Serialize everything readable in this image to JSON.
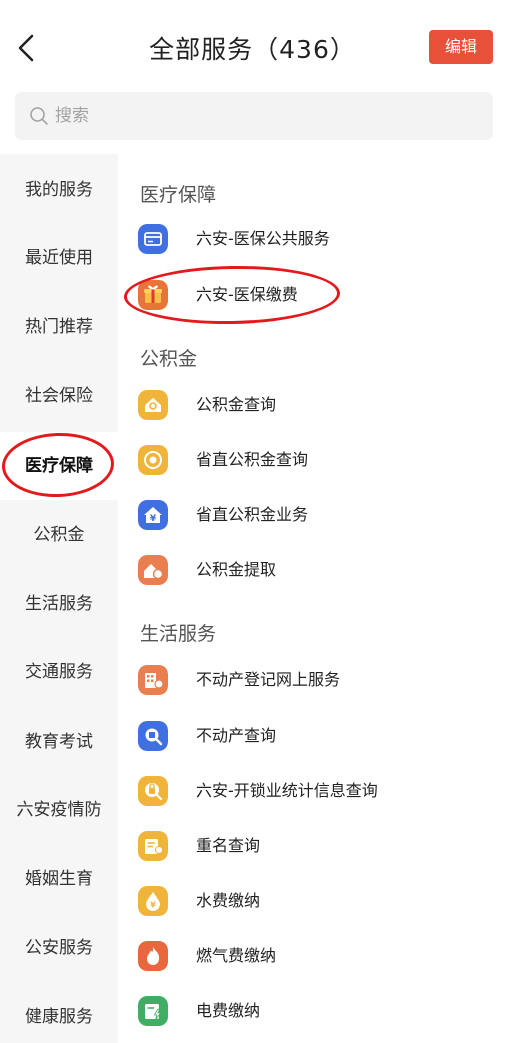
{
  "header": {
    "title": "全部服务（436）",
    "edit_label": "编辑"
  },
  "search": {
    "placeholder": "搜索"
  },
  "sidebar": {
    "items": [
      {
        "label": "我的服务"
      },
      {
        "label": "最近使用"
      },
      {
        "label": "热门推荐"
      },
      {
        "label": "社会保险"
      },
      {
        "label": "医疗保障",
        "active": true
      },
      {
        "label": "公积金"
      },
      {
        "label": "生活服务"
      },
      {
        "label": "交通服务"
      },
      {
        "label": "教育考试"
      },
      {
        "label": "六安疫情防"
      },
      {
        "label": "婚姻生育"
      },
      {
        "label": "公安服务"
      },
      {
        "label": "健康服务"
      }
    ]
  },
  "sections": {
    "medical": {
      "title": "医疗保障",
      "items": [
        {
          "label": "六安-医保公共服务",
          "icon": "card-icon",
          "color": "#3f6fe0"
        },
        {
          "label": "六安-医保缴费",
          "icon": "gift-icon",
          "color": "#e8743a"
        }
      ]
    },
    "fund": {
      "title": "公积金",
      "items": [
        {
          "label": "公积金查询",
          "icon": "house-search-icon",
          "color": "#f1b43a"
        },
        {
          "label": "省直公积金查询",
          "icon": "target-icon",
          "color": "#f1b43a"
        },
        {
          "label": "省直公积金业务",
          "icon": "yuan-house-icon",
          "color": "#3f6fe0"
        },
        {
          "label": "公积金提取",
          "icon": "house-coin-icon",
          "color": "#e97e4f"
        }
      ]
    },
    "life": {
      "title": "生活服务",
      "items": [
        {
          "label": "不动产登记网上服务",
          "icon": "building-icon",
          "color": "#e97e4f"
        },
        {
          "label": "不动产查询",
          "icon": "doc-search-icon",
          "color": "#3f6fe0"
        },
        {
          "label": "六安-开锁业统计信息查询",
          "icon": "lock-icon",
          "color": "#f1b43a"
        },
        {
          "label": "重名查询",
          "icon": "name-card-icon",
          "color": "#f1b43a"
        },
        {
          "label": "水费缴纳",
          "icon": "water-drop-icon",
          "color": "#f1b43a"
        },
        {
          "label": "燃气费缴纳",
          "icon": "flame-icon",
          "color": "#e9673d"
        },
        {
          "label": "电费缴纳",
          "icon": "electric-icon",
          "color": "#3fae64"
        }
      ]
    }
  },
  "colors": {
    "accent": "#e8503a",
    "highlight_circle": "#e3191c"
  }
}
